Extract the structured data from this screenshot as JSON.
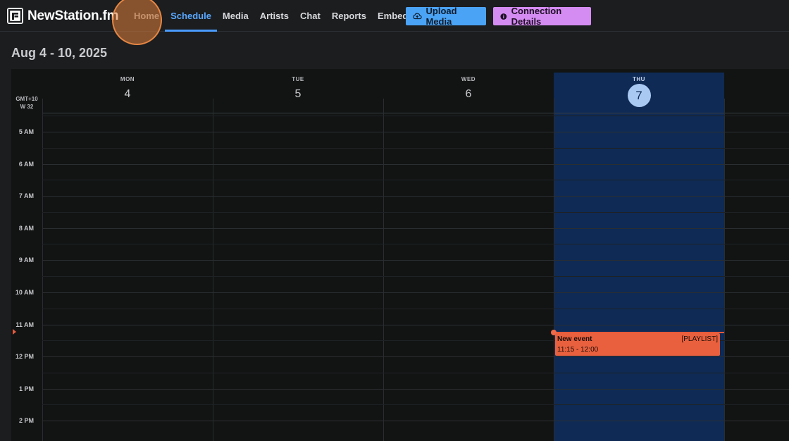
{
  "app": {
    "name": "NewStation.fm"
  },
  "nav": {
    "items": [
      {
        "label": "Home"
      },
      {
        "label": "Schedule"
      },
      {
        "label": "Media"
      },
      {
        "label": "Artists"
      },
      {
        "label": "Chat"
      },
      {
        "label": "Reports"
      },
      {
        "label": "Embeds"
      }
    ],
    "active": "Schedule",
    "upload_label": "Upload Media",
    "connection_label": "Connection Details"
  },
  "calendar": {
    "title": "Aug 4 - 10, 2025",
    "timezone": "GMT+10",
    "week": "W 32",
    "days": [
      {
        "name": "MON",
        "date": "4"
      },
      {
        "name": "TUE",
        "date": "5"
      },
      {
        "name": "WED",
        "date": "6"
      },
      {
        "name": "THU",
        "date": "7"
      }
    ],
    "today": "THU",
    "hours": [
      "5 AM",
      "6 AM",
      "7 AM",
      "8 AM",
      "9 AM",
      "10 AM",
      "11 AM",
      "12 PM",
      "1 PM",
      "2 PM"
    ],
    "event": {
      "title": "New event",
      "time": "11:15 - 12:00",
      "tag": "[PLAYLIST]"
    }
  },
  "colors": {
    "accent": "#4a9bff",
    "upload": "#4aa3f5",
    "connection": "#d58cf2",
    "today_column": "#0e2a55",
    "event": "#e8603e",
    "now": "#e65a3a"
  },
  "icons": [
    "logo-icon",
    "cloud-upload-icon",
    "info-icon"
  ]
}
